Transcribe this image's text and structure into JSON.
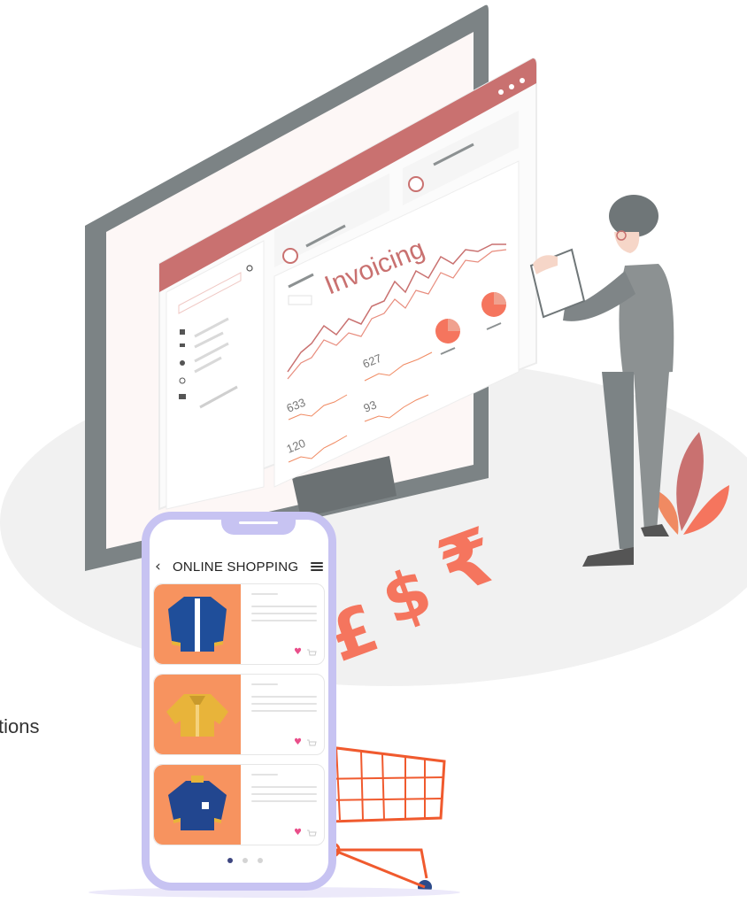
{
  "phone": {
    "title": "ONLINE SHOPPING",
    "back_icon": "chevron-left-icon",
    "menu_icon": "hamburger-menu-icon",
    "products": [
      {
        "item": "blue-cardigan",
        "color": "#1f4e9a"
      },
      {
        "item": "yellow-jacket",
        "color": "#e8b43a"
      },
      {
        "item": "navy-sweater",
        "color": "#22468f"
      }
    ],
    "pages": 3,
    "active_page": 1
  },
  "screen": {
    "heading": "Invoicing",
    "stats": [
      "627",
      "633",
      "93",
      "120"
    ]
  },
  "floor": {
    "currency_symbols": [
      "£",
      "$",
      "₹"
    ]
  },
  "partial_text": "tions",
  "colors": {
    "accent_red": "#c97170",
    "coral": "#f5755e",
    "phone_frame": "#c7c3f2",
    "monitor": "#7c8385",
    "card_orange": "#f7935f"
  }
}
